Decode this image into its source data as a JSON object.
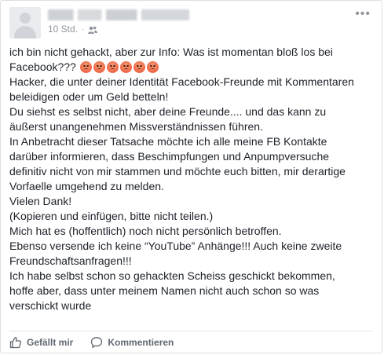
{
  "post": {
    "timestamp": "10 Std.",
    "separator": "·",
    "audience_icon": "friends-icon",
    "more_icon": "ellipsis-icon",
    "lines": [
      "ich bin nicht gehackt, aber zur Info: Was ist momentan bloß los bei",
      "Facebook???",
      "Hacker, die unter deiner Identität Facebook-Freunde mit Kommentaren",
      "beleidigen oder um Geld betteln!",
      "Du siehst es selbst nicht, aber deine Freunde.... und das kann zu",
      "äußerst unangenehmen Missverständnissen führen.",
      "In Anbetracht dieser Tatsache möchte ich alle meine FB Kontakte",
      "darüber informieren, dass Beschimpfungen und Anpumpversuche",
      "definitiv nicht von mir stammen und möchte euch bitten, mir derartige",
      "Vorfaelle umgehend zu melden.",
      "Vielen Dank!",
      "(Kopieren und einfügen, bitte nicht teilen.)",
      "Mich hat es (hoffentlich) noch nicht persönlich betroffen.",
      "Ebenso versende ich keine “YouTube” Anhänge!!! Auch keine zweite",
      "Freundschaftsanfragen!!!",
      "Ich habe selbst schon so gehackten Scheiss geschickt bekommen,",
      "hoffe aber, dass unter meinem Namen nicht auch schon so was",
      "verschickt wurde"
    ],
    "emoji_count": 6,
    "emoji_name": "angry-face-emoji"
  },
  "actions": {
    "like_label": "Gefällt mir",
    "comment_label": "Kommentieren",
    "like_icon": "thumbs-up-icon",
    "comment_icon": "comment-bubble-icon"
  },
  "colors": {
    "text": "#1d2129",
    "meta": "#90949c",
    "action": "#606770",
    "border": "#dddfe2"
  }
}
